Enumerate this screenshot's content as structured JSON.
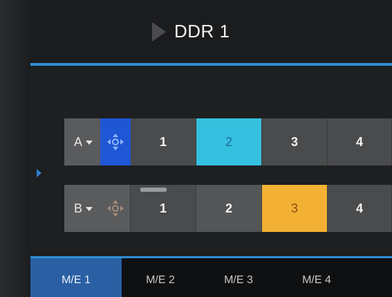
{
  "header": {
    "title": "DDR 1"
  },
  "rows": [
    {
      "bus_label": "A",
      "move_active": true,
      "sources": [
        {
          "label": "1",
          "state": "normal"
        },
        {
          "label": "2",
          "state": "preview"
        },
        {
          "label": "3",
          "state": "normal"
        },
        {
          "label": "4",
          "state": "normal"
        }
      ]
    },
    {
      "bus_label": "B",
      "move_active": false,
      "sources": [
        {
          "label": "1",
          "state": "normal"
        },
        {
          "label": "2",
          "state": "normal"
        },
        {
          "label": "3",
          "state": "program"
        },
        {
          "label": "4",
          "state": "normal"
        }
      ]
    }
  ],
  "tabs": [
    "M/E 1",
    "M/E 2",
    "M/E 3",
    "M/E 4"
  ],
  "active_tab": "M/E 1",
  "colors": {
    "accent": "#2e8fd8",
    "preview": "#35c0e0",
    "program": "#f2b134",
    "move_active": "#1f56d6"
  }
}
